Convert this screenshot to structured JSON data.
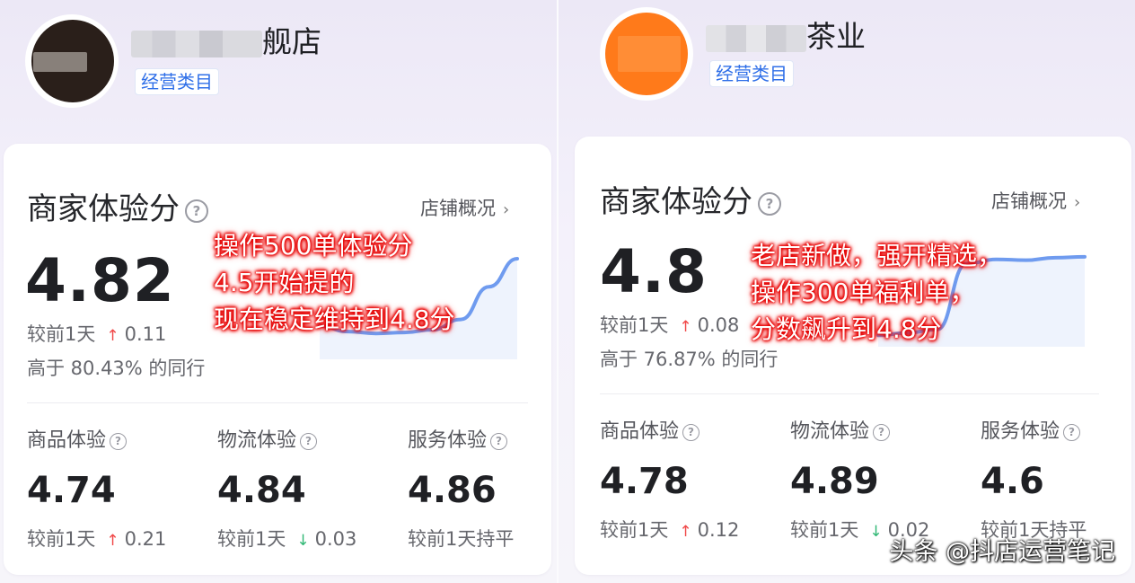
{
  "panels": [
    {
      "avatar_color": "#2a1f1a",
      "shop_name_suffix": "舰店",
      "category_tag": "经营类目",
      "score_title": "商家体验分",
      "overview_link": "店铺概况",
      "overview_chevron": "›",
      "main_score": "4.82",
      "compare_label": "较前1天",
      "compare_arrow": "↑",
      "compare_value": "0.11",
      "percentile_text": "高于 80.43% 的同行",
      "annotation": [
        "操作500单体验分",
        "4.5开始提的",
        "现在稳定维持到4.8分"
      ],
      "sub_scores": [
        {
          "label": "商品体验",
          "score": "4.74",
          "compare_label": "较前1天",
          "arrow": "↑",
          "arrow_dir": "up",
          "value": "0.21"
        },
        {
          "label": "物流体验",
          "score": "4.84",
          "compare_label": "较前1天",
          "arrow": "↓",
          "arrow_dir": "down",
          "value": "0.03"
        },
        {
          "label": "服务体验",
          "score": "4.86",
          "compare_label": "较前1天持平",
          "arrow": "",
          "arrow_dir": "flat",
          "value": ""
        }
      ],
      "trend": [
        0.28,
        0.22,
        0.2,
        0.21,
        0.24,
        0.35,
        0.7,
        1.0
      ]
    },
    {
      "avatar_color": "#ff7a1a",
      "shop_name_suffix": "茶业",
      "category_tag": "经营类目",
      "score_title": "商家体验分",
      "overview_link": "店铺概况",
      "overview_chevron": "›",
      "main_score": "4.8",
      "compare_label": "较前1天",
      "compare_arrow": "↑",
      "compare_value": "0.08",
      "percentile_text": "高于 76.87% 的同行",
      "annotation": [
        "老店新做，强开精选，",
        "操作300单福利单，",
        "分数飙升到4.8分"
      ],
      "sub_scores": [
        {
          "label": "商品体验",
          "score": "4.78",
          "compare_label": "较前1天",
          "arrow": "↑",
          "arrow_dir": "up",
          "value": "0.12"
        },
        {
          "label": "物流体验",
          "score": "4.89",
          "compare_label": "较前1天",
          "arrow": "↓",
          "arrow_dir": "down",
          "value": "0.02"
        },
        {
          "label": "服务体验",
          "score": "4.6",
          "compare_label": "较前1天持平",
          "arrow": "",
          "arrow_dir": "flat",
          "value": ""
        }
      ],
      "trend": [
        0.05,
        0.08,
        0.12,
        0.9,
        0.95,
        0.94,
        0.97,
        0.98
      ]
    }
  ],
  "watermark": "头条 @抖店运营笔记",
  "colors": {
    "accent_blue": "#2f6fe8",
    "trend_line": "#6f9bef",
    "up": "#f04848",
    "down": "#2fb774"
  }
}
